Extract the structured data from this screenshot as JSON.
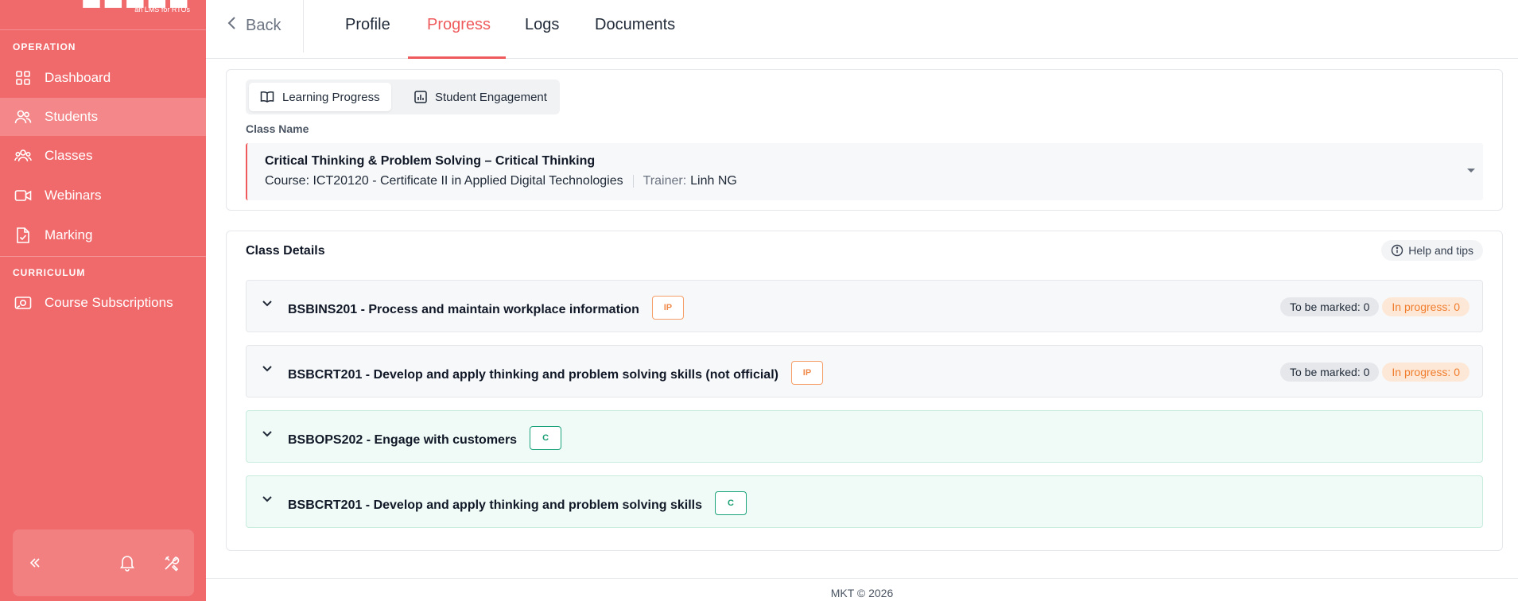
{
  "brand": {
    "subtitle": "an LMS for RTOs"
  },
  "sidebar": {
    "sections": [
      "OPERATION",
      "CURRICULUM"
    ],
    "items": [
      {
        "label": "Dashboard",
        "icon": "grid-icon"
      },
      {
        "label": "Students",
        "icon": "users-icon",
        "active": true
      },
      {
        "label": "Classes",
        "icon": "group-icon"
      },
      {
        "label": "Webinars",
        "icon": "video-icon"
      },
      {
        "label": "Marking",
        "icon": "file-check-icon"
      },
      {
        "label": "Course Subscriptions",
        "icon": "subscription-icon"
      }
    ],
    "footer_icons": [
      "collapse-icon",
      "bell-icon",
      "tools-icon"
    ]
  },
  "topbar": {
    "back_label": "Back",
    "tabs": [
      "Profile",
      "Progress",
      "Logs",
      "Documents"
    ],
    "active_tab": "Progress"
  },
  "progress": {
    "segments": [
      "Learning Progress",
      "Student Engagement"
    ],
    "active_segment": "Learning Progress",
    "class_name_label": "Class Name",
    "class": {
      "title": "Critical Thinking & Problem Solving – Critical Thinking",
      "course_label": "Course:",
      "course": "ICT20120 - Certificate II in Applied Digital Technologies",
      "trainer_label": "Trainer:",
      "trainer": "Linh NG"
    }
  },
  "details": {
    "title": "Class Details",
    "help_label": "Help and tips",
    "units": [
      {
        "title": "BSBINS201 - Process and maintain workplace information",
        "status": "IP",
        "to_be_marked": "To be marked: 0",
        "in_progress": "In progress: 0"
      },
      {
        "title": "BSBCRT201 - Develop and apply thinking and problem solving skills (not official)",
        "status": "IP",
        "to_be_marked": "To be marked: 0",
        "in_progress": "In progress: 0"
      },
      {
        "title": "BSBOPS202 - Engage with customers",
        "status": "C"
      },
      {
        "title": "BSBCRT201 - Develop and apply thinking and problem solving skills",
        "status": "C"
      }
    ]
  },
  "footer": {
    "text": "MKT © 2026"
  },
  "colors": {
    "accent": "#ef5b5d",
    "sidebar": "#f06a6c",
    "ip": "#f08a4b",
    "complete": "#1a9e74"
  }
}
